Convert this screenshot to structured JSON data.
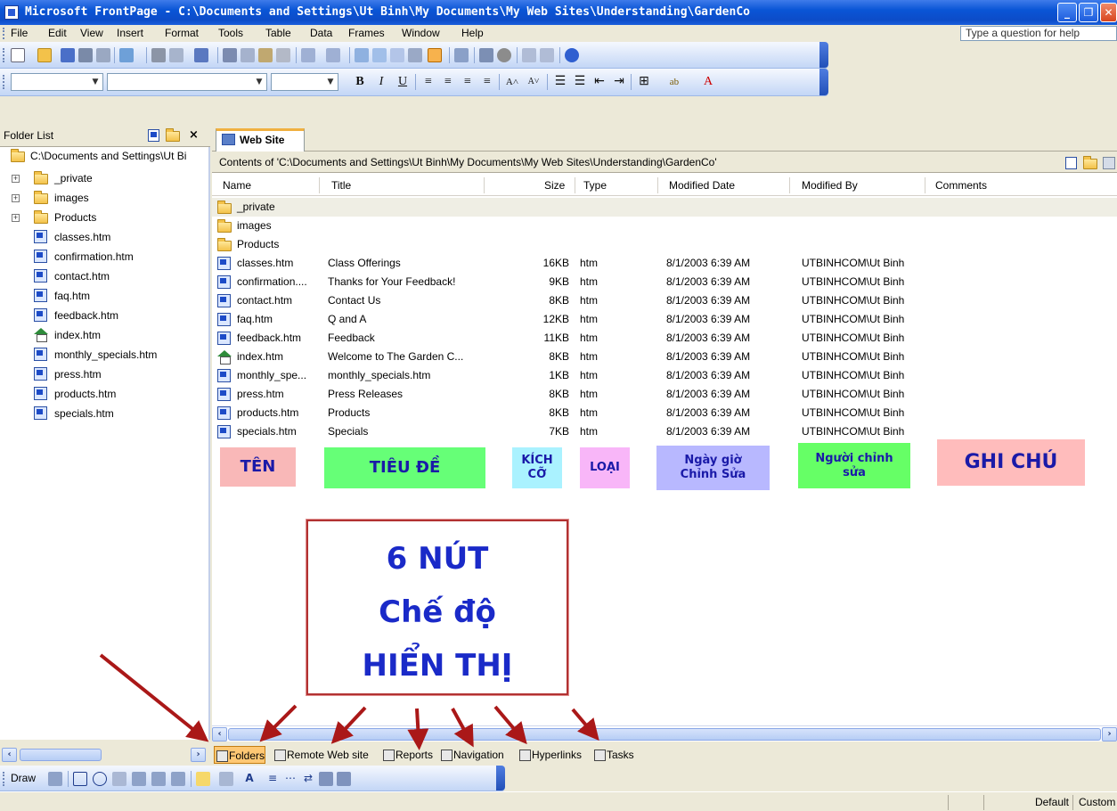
{
  "window": {
    "title": "Microsoft FrontPage - C:\\Documents and Settings\\Ut Binh\\My Documents\\My Web Sites\\Understanding\\GardenCo"
  },
  "menubar": {
    "items": [
      "File",
      "Edit",
      "View",
      "Insert",
      "Format",
      "Tools",
      "Table",
      "Data",
      "Frames",
      "Window",
      "Help"
    ],
    "help_placeholder": "Type a question for help"
  },
  "folder_list": {
    "header": "Folder List",
    "root": "C:\\Documents and Settings\\Ut Bi",
    "items": [
      {
        "name": "_private",
        "icon": "folder-icon",
        "expandable": true
      },
      {
        "name": "images",
        "icon": "folder-icon",
        "expandable": true
      },
      {
        "name": "Products",
        "icon": "folder-icon",
        "expandable": true
      },
      {
        "name": "classes.htm",
        "icon": "web-page-icon"
      },
      {
        "name": "confirmation.htm",
        "icon": "web-page-icon"
      },
      {
        "name": "contact.htm",
        "icon": "web-page-icon"
      },
      {
        "name": "faq.htm",
        "icon": "web-page-icon"
      },
      {
        "name": "feedback.htm",
        "icon": "web-page-icon"
      },
      {
        "name": "index.htm",
        "icon": "home-page-icon"
      },
      {
        "name": "monthly_specials.htm",
        "icon": "web-page-icon"
      },
      {
        "name": "press.htm",
        "icon": "web-page-icon"
      },
      {
        "name": "products.htm",
        "icon": "web-page-icon"
      },
      {
        "name": "specials.htm",
        "icon": "web-page-icon"
      }
    ]
  },
  "tab": {
    "label": "Web Site"
  },
  "contents_label": "Contents of 'C:\\Documents and Settings\\Ut Binh\\My Documents\\My Web Sites\\Understanding\\GardenCo'",
  "table": {
    "columns": [
      "Name",
      "Title",
      "Size",
      "Type",
      "Modified Date",
      "Modified By",
      "Comments"
    ],
    "rows": [
      {
        "name": "_private",
        "title": "",
        "size": "",
        "type": "",
        "date": "",
        "by": "",
        "icon": "folder-icon"
      },
      {
        "name": "images",
        "title": "",
        "size": "",
        "type": "",
        "date": "",
        "by": "",
        "icon": "folder-icon"
      },
      {
        "name": "Products",
        "title": "",
        "size": "",
        "type": "",
        "date": "",
        "by": "",
        "icon": "folder-icon"
      },
      {
        "name": "classes.htm",
        "title": "Class Offerings",
        "size": "16KB",
        "type": "htm",
        "date": "8/1/2003 6:39 AM",
        "by": "UTBINHCOM\\Ut Binh",
        "icon": "web-page-icon"
      },
      {
        "name": "confirmation....",
        "title": "Thanks for Your Feedback!",
        "size": "9KB",
        "type": "htm",
        "date": "8/1/2003 6:39 AM",
        "by": "UTBINHCOM\\Ut Binh",
        "icon": "web-page-icon"
      },
      {
        "name": "contact.htm",
        "title": "Contact Us",
        "size": "8KB",
        "type": "htm",
        "date": "8/1/2003 6:39 AM",
        "by": "UTBINHCOM\\Ut Binh",
        "icon": "web-page-icon"
      },
      {
        "name": "faq.htm",
        "title": "Q and A",
        "size": "12KB",
        "type": "htm",
        "date": "8/1/2003 6:39 AM",
        "by": "UTBINHCOM\\Ut Binh",
        "icon": "web-page-icon"
      },
      {
        "name": "feedback.htm",
        "title": "Feedback",
        "size": "11KB",
        "type": "htm",
        "date": "8/1/2003 6:39 AM",
        "by": "UTBINHCOM\\Ut Binh",
        "icon": "web-page-icon"
      },
      {
        "name": "index.htm",
        "title": "Welcome to The Garden C...",
        "size": "8KB",
        "type": "htm",
        "date": "8/1/2003 6:39 AM",
        "by": "UTBINHCOM\\Ut Binh",
        "icon": "home-page-icon"
      },
      {
        "name": "monthly_spe...",
        "title": "monthly_specials.htm",
        "size": "1KB",
        "type": "htm",
        "date": "8/1/2003 6:39 AM",
        "by": "UTBINHCOM\\Ut Binh",
        "icon": "web-page-icon"
      },
      {
        "name": "press.htm",
        "title": "Press Releases",
        "size": "8KB",
        "type": "htm",
        "date": "8/1/2003 6:39 AM",
        "by": "UTBINHCOM\\Ut Binh",
        "icon": "web-page-icon"
      },
      {
        "name": "products.htm",
        "title": "Products",
        "size": "8KB",
        "type": "htm",
        "date": "8/1/2003 6:39 AM",
        "by": "UTBINHCOM\\Ut Binh",
        "icon": "web-page-icon"
      },
      {
        "name": "specials.htm",
        "title": "Specials",
        "size": "7KB",
        "type": "htm",
        "date": "8/1/2003 6:39 AM",
        "by": "UTBINHCOM\\Ut Binh",
        "icon": "web-page-icon"
      }
    ]
  },
  "annotations": {
    "ten": "TÊN",
    "tieu_de": "TIÊU ĐỀ",
    "kich_co_1": "KÍCH",
    "kich_co_2": "CỠ",
    "loai": "LOẠI",
    "ngay_gio_1": "Ngày giờ",
    "ngay_gio_2": "Chỉnh Sửa",
    "nguoi_1": "Người chỉnh",
    "nguoi_2": "sửa",
    "ghi_chu": "GHI CHÚ",
    "callout_line1": "6 NÚT",
    "callout_line2": "Chế độ",
    "callout_line3": "HIỂN THỊ",
    "colors": {
      "ten": "#f9b8b8",
      "tieu_de": "#66ff77",
      "kich_co": "#aaf2ff",
      "loai": "#f8b6f8",
      "ngay_gio": "#b8b8ff",
      "nguoi": "#66ff66",
      "ghi_chu": "#ffbcbc",
      "arrow": "#aa1818"
    }
  },
  "views": {
    "buttons": [
      "Folders",
      "Remote Web site",
      "Reports",
      "Navigation",
      "Hyperlinks",
      "Tasks"
    ],
    "active": "Folders"
  },
  "drawing_toolbar": {
    "draw_label": "Draw"
  },
  "statusbar": {
    "mode": "Default",
    "custom": "Custom"
  }
}
